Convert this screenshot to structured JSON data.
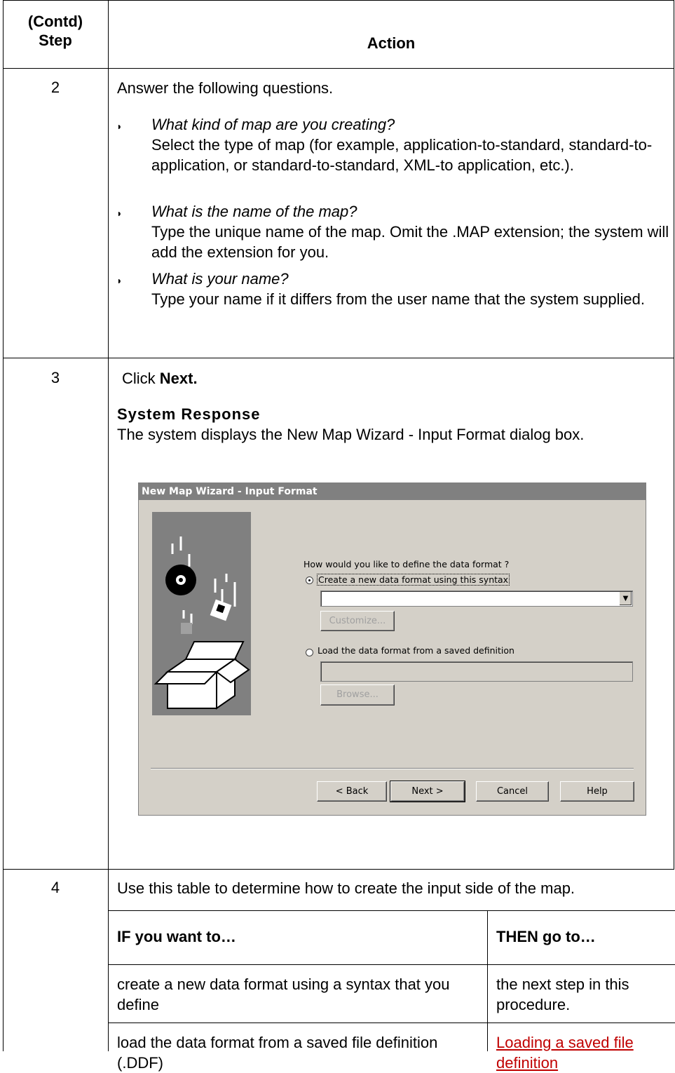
{
  "table": {
    "header": {
      "step": "(Contd)\nStep",
      "action": "Action"
    },
    "rows": [
      {
        "step": "2",
        "intro": "Answer the following questions.",
        "items": [
          {
            "question": "What kind of map are you creating?",
            "answer": "Select the type of map (for example, application-to-standard, standard-to-application, or standard-to-standard, XML-to application, etc.)."
          },
          {
            "question": "What is the name of the map?",
            "answer": "Type the unique name of the map. Omit the .MAP extension; the system will add the extension for you."
          },
          {
            "question": "What is your name?",
            "answer": "Type your name if it differs from the user name that the system supplied."
          }
        ]
      },
      {
        "step": "3",
        "click_prefix": "Click ",
        "click_bold": "Next.",
        "response_heading": "System Response",
        "response_text": "The system displays the New Map Wizard - Input Format dialog box."
      },
      {
        "step": "4",
        "intro": "Use this table to determine how to create the input side of the map.",
        "subtable": {
          "headers": [
            "IF you want to…",
            "THEN go to…"
          ],
          "rows": [
            [
              "create a new data format using a syntax that you define",
              "the next step in this procedure."
            ],
            [
              "load the data format from a saved file definition (.DDF)",
              "Loading a saved file definition"
            ]
          ]
        }
      }
    ]
  },
  "dialog": {
    "title": "New Map Wizard - Input Format",
    "question": "How would you like to define the data format ?",
    "option_new": "Create a new data format using this syntax",
    "syntax_value": "",
    "customize": "Customize...",
    "option_load": "Load the data format from a saved definition",
    "load_value": "",
    "browse": "Browse...",
    "back": "< Back",
    "next": "Next >",
    "cancel": "Cancel",
    "help": "Help"
  }
}
